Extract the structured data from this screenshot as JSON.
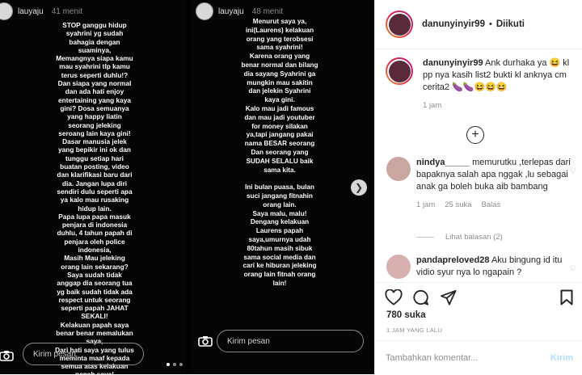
{
  "left_story": {
    "username": "lauyaju",
    "time": "41 menit",
    "text": "STOP ganggu hidup\nsyahrini yg sudah\nbahagia dengan\nsuaminya,\nMemangnya siapa kamu\nmau syahrini tlp kamu\nterus seperti duhlu!?\nDan siapa yang normal\ndan ada hati enjoy\nentertaining yang kaya\ngini? Dosa semuanya\nyang happy liatin\nseorang jeleking\nseroang lain kaya gini!\nDasar manusia jelek\nyang bepikir ini ok dan\ntunggu setiap hari\nbuatan posting, video\ndan klarifikasi baru dari\ndia. Jangan lupa diri\nsendiri dulu seperti apa\nya kalo mau rusaking\nhidup lain.\nPapa lupa papa masuk\npenjara di indonesia\nduhlu, 4 tahun papah di\npenjara oleh police\nindonesia,\nMasih Mau jeleking\norang lain sekarang?\nSaya sudah tidak\nanggap dia seorang tua\nyg baik sudah tidak ada\nrespect untuk seorang\nseperti papah JAHAT\nSEKALI!\nKelakuan papah saya\nbenar benar memalukan\nsaya,\nDari hati saya yang tulus\nmeminta maaf kepada\nsemua atas kelakuan\npapah saya!",
    "message_placeholder": "Kirim pesan"
  },
  "right_story": {
    "username": "lauyaju",
    "time": "48 menit",
    "text": "Menurut saya ya,\nini(Laurens) kelakuan\norang yang terobsesi\nsama syahrini!\nKarena orang yang\nbenar normal dan bilang\ndia sayang Syahrini ga\nmungkin mau sakitin\ndan jelekin Syahrini\nkaya gini.\nKalo mau jadi famous\ndan mau jadi youtuber\nfor money silakan\nya,tapi jangang pakai\nnama BESAR seorang\nDan seorang yang\nSUDAH SELALU baik\nsama kita.\n\nIni bulan puasa, bulan\nsuci jangang fitnahin\norang lain.\nSaya malu, malu!\nDengang kelakuan\nLaurens papah\nsaya,umurnya udah\n80tahun masih sibuk\nsama social media dan\ncari ke hiburan jeleking\norang lain fitnah orang\nlain!",
    "message_placeholder": "Kirim pesan"
  },
  "post": {
    "username": "danunyinyir99",
    "separator": "•",
    "follow_status": "Diikuti"
  },
  "comments": [
    {
      "username": "danunyinyir99",
      "text": "Ank durhaka ya 😆 kl pp nya kasih list2 bukti kl anknya cm cerita2 🍆🍆😆😆😆",
      "time": "1 jam",
      "avatar_color": "#5a2a3a"
    },
    {
      "username": "nindya_____",
      "text": "memurutku ,terlepas dari bapaknya salah apa nggak ,lu sebagai anak ga boleh buka aib bambang",
      "time": "1 jam",
      "likes": "25 suka",
      "reply": "Balas",
      "view_replies": "Lihat balasan (2)",
      "avatar_color": "#c9a6a0"
    },
    {
      "username": "pandapreloved28",
      "text": "Aku bingung id itu vidio syur nya lo ngapain ?",
      "avatar_color": "#d9b0b0"
    }
  ],
  "likes": "780 suka",
  "time_ago": "1 JAM YANG LALU",
  "add_comment": {
    "placeholder": "Tambahkan komentar...",
    "post_label": "Kirim"
  },
  "colors": {
    "accent": "#b2dffc",
    "text": "#262626",
    "muted": "#8e8e8e"
  }
}
